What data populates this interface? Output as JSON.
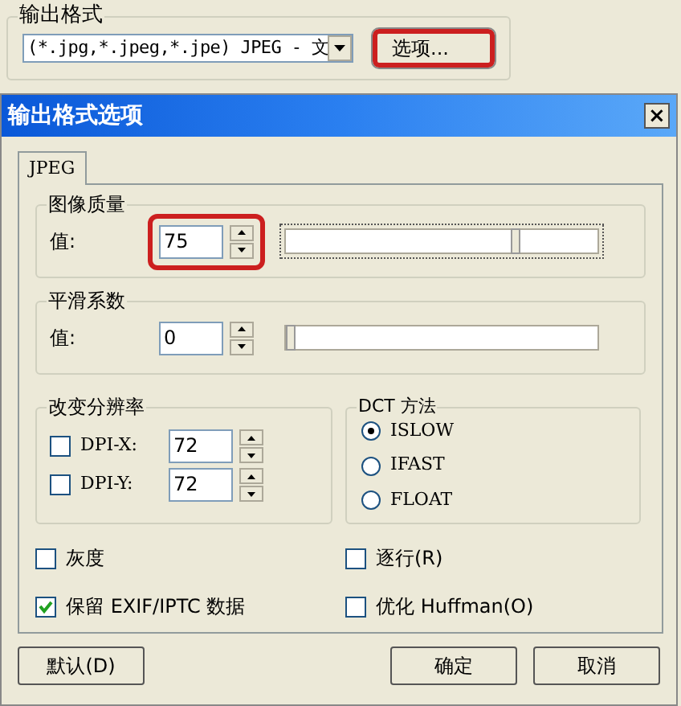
{
  "output_format": {
    "title": "输出格式",
    "format_value": "(*.jpg,*.jpeg,*.jpe) JPEG - 文",
    "options_button": {
      "label": "选项...",
      "highlighted": true
    }
  },
  "dialog": {
    "title": "输出格式选项",
    "close": "×",
    "tabs": [
      {
        "label": "JPEG",
        "selected": true
      }
    ],
    "quality": {
      "title": "图像质量",
      "label": "值:",
      "value": "75",
      "highlighted": true,
      "level": 0.75
    },
    "smoothing": {
      "title": "平滑系数",
      "label": "值:",
      "value": "0",
      "level": 0
    },
    "resolution": {
      "title": "改变分辨率",
      "rows": [
        {
          "label": "DPI-X:",
          "checked": false,
          "value": "72"
        },
        {
          "label": "DPI-Y:",
          "checked": false,
          "value": "72"
        }
      ]
    },
    "dct": {
      "title": "DCT 方法",
      "options": [
        {
          "label": "ISLOW",
          "selected": true
        },
        {
          "label": "IFAST",
          "selected": false
        },
        {
          "label": "FLOAT",
          "selected": false
        }
      ]
    },
    "checkboxes": [
      {
        "label": "灰度",
        "checked": false
      },
      {
        "label": "逐行(R)",
        "checked": false
      },
      {
        "label": "保留 EXIF/IPTC 数据",
        "checked": true
      },
      {
        "label": "优化 Huffman(O)",
        "checked": false
      }
    ],
    "buttons": [
      {
        "label": "默认(D)"
      },
      {
        "label": "确定"
      },
      {
        "label": "取消"
      }
    ]
  }
}
